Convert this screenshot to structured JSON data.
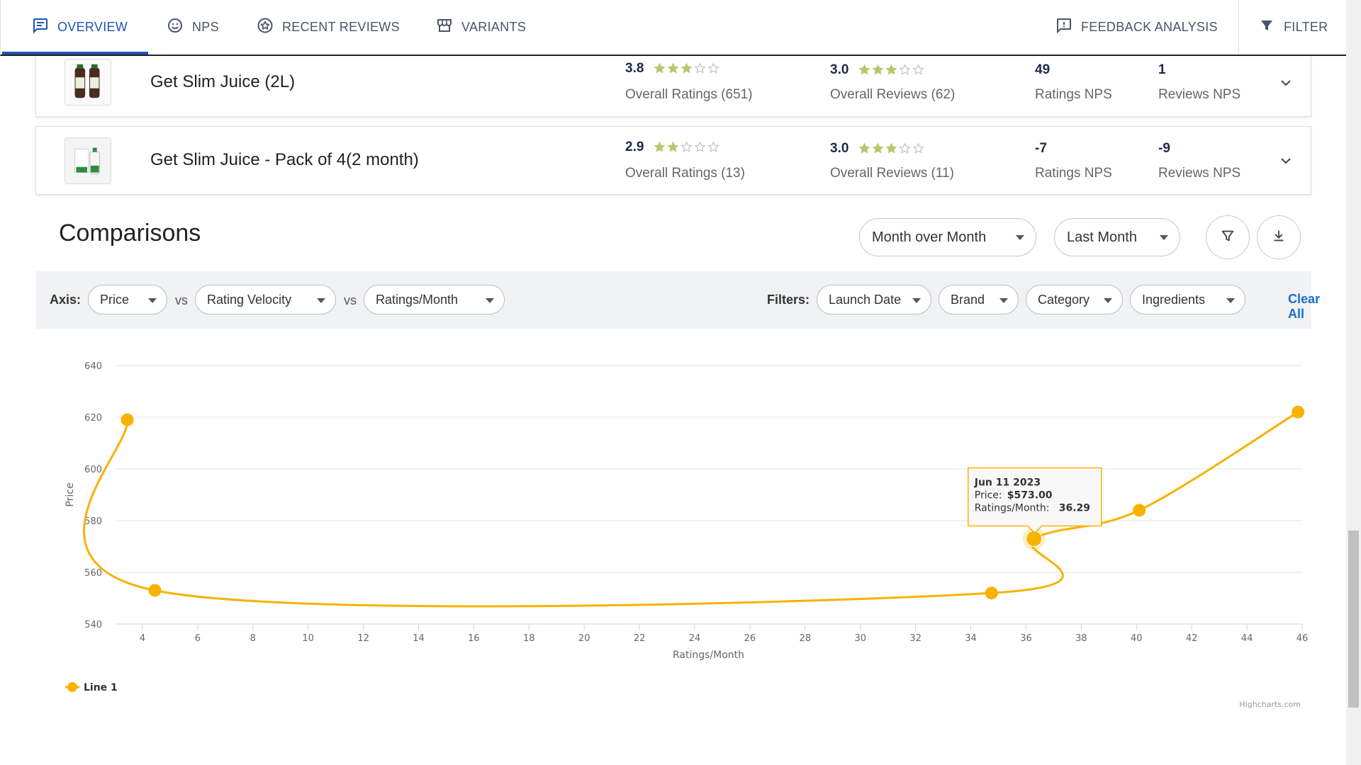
{
  "nav": {
    "tabs": [
      {
        "label": "OVERVIEW",
        "icon": "message-icon"
      },
      {
        "label": "NPS",
        "icon": "smile-icon"
      },
      {
        "label": "RECENT REVIEWS",
        "icon": "star-badge-icon"
      },
      {
        "label": "VARIANTS",
        "icon": "store-icon"
      }
    ],
    "feedback_label": "FEEDBACK ANALYSIS",
    "filter_label": "FILTER",
    "accent": "#1a56b4"
  },
  "products": [
    {
      "name": "Get Slim Juice (2L)",
      "overall_rating": "3.8",
      "rating_stars": 3,
      "overall_ratings_label": "Overall Ratings (651)",
      "overall_review": "3.0",
      "review_stars": 3,
      "overall_reviews_label": "Overall Reviews (62)",
      "ratings_nps": "49",
      "ratings_nps_label": "Ratings NPS",
      "reviews_nps": "1",
      "reviews_nps_label": "Reviews NPS"
    },
    {
      "name": "Get Slim Juice - Pack of 4(2 month)",
      "overall_rating": "2.9",
      "rating_stars": 2,
      "overall_ratings_label": "Overall Ratings (13)",
      "overall_review": "3.0",
      "review_stars": 3,
      "overall_reviews_label": "Overall Reviews (11)",
      "ratings_nps": "-7",
      "ratings_nps_label": "Ratings NPS",
      "reviews_nps": "-9",
      "reviews_nps_label": "Reviews NPS"
    }
  ],
  "comparisons": {
    "title": "Comparisons",
    "period_mode": "Month over Month",
    "period_range": "Last Month",
    "axis_label": "Axis:",
    "axis_x": "Price",
    "vs1": "vs",
    "axis_y": "Rating Velocity",
    "vs2": "vs",
    "axis_z": "Ratings/Month",
    "filters_label": "Filters:",
    "filters": [
      "Launch Date",
      "Brand",
      "Category",
      "Ingredients"
    ],
    "clear_all": "Clear All"
  },
  "chart_data": {
    "type": "line",
    "ylabel": "Price",
    "xlabel": "Ratings/Month",
    "xlim": [
      3,
      46
    ],
    "ylim": [
      540,
      640
    ],
    "x_ticks": [
      4,
      6,
      8,
      10,
      12,
      14,
      16,
      18,
      20,
      22,
      24,
      26,
      28,
      30,
      32,
      34,
      36,
      38,
      40,
      42,
      44,
      46
    ],
    "y_ticks": [
      540,
      560,
      580,
      600,
      620,
      640
    ],
    "series": [
      {
        "name": "Line 1",
        "color": "#f8b200",
        "points": [
          [
            3.45,
            619
          ],
          [
            4.45,
            553
          ],
          [
            34.75,
            552
          ],
          [
            36.29,
            573
          ],
          [
            40.1,
            584
          ],
          [
            45.85,
            622
          ]
        ]
      }
    ],
    "tooltip": {
      "date": "Jun 11 2023",
      "price_label": "Price:",
      "price_value": "$573.00",
      "rpm_label": "Ratings/Month:",
      "rpm_value": "36.29"
    },
    "legend": "bottom-left",
    "grid": true,
    "credits": "Highcharts.com"
  }
}
